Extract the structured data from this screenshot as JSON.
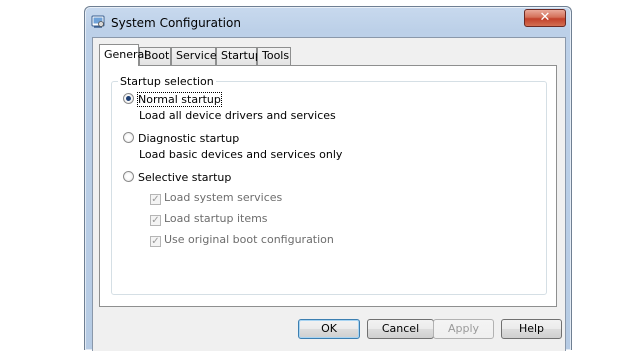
{
  "window": {
    "title": "System Configuration",
    "close_label": "✕",
    "icon": "system-config-icon"
  },
  "tabs": [
    {
      "label": "General",
      "active": true
    },
    {
      "label": "Boot",
      "active": false
    },
    {
      "label": "Services",
      "active": false
    },
    {
      "label": "Startup",
      "active": false
    },
    {
      "label": "Tools",
      "active": false
    }
  ],
  "startup_selection": {
    "group_title": "Startup selection",
    "normal": {
      "label": "Normal startup",
      "description": "Load all device drivers and services",
      "checked": true
    },
    "diagnostic": {
      "label": "Diagnostic startup",
      "description": "Load basic devices and services only",
      "checked": false
    },
    "selective": {
      "label": "Selective startup",
      "checked": false,
      "options": [
        {
          "label": "Load system services",
          "checked": true,
          "enabled": false
        },
        {
          "label": "Load startup items",
          "checked": true,
          "enabled": false
        },
        {
          "label": "Use original boot configuration",
          "checked": true,
          "enabled": false
        }
      ]
    }
  },
  "buttons": {
    "ok": "OK",
    "cancel": "Cancel",
    "apply": "Apply",
    "help": "Help"
  },
  "colors": {
    "accent_blue": "#3c7fb1",
    "close_red": "#c2412b"
  }
}
